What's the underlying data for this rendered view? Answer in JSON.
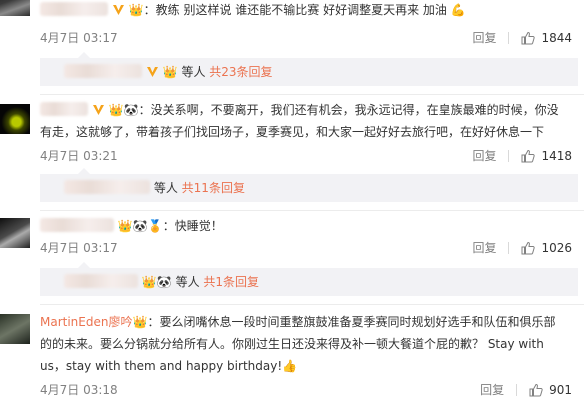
{
  "comments": [
    {
      "separator": "：",
      "text": "教练 别这样说 谁还能不输比赛 好好调整夏天再来 加油",
      "emoji": "💪",
      "time": "4月7日 03:17",
      "reply_label": "回复",
      "likes": "1844",
      "sub": {
        "suffix": "等人",
        "more": "共23条回复"
      }
    },
    {
      "separator": "：",
      "line1": "没关系啊，不要离开，我们还有机会，我永远记得，在皇族最难的时候，你没",
      "line2": "有走，这就够了，带着孩子们找回场子，夏季赛见，和大家一起好好去旅行吧，在好好休息一下",
      "time": "4月7日 03:21",
      "reply_label": "回复",
      "likes": "1418",
      "sub": {
        "suffix": "等人",
        "more": "共11条回复"
      }
    },
    {
      "separator": "：",
      "text": "快睡觉！",
      "time": "4月7日 03:17",
      "reply_label": "回复",
      "likes": "1026",
      "sub": {
        "suffix": "等人",
        "more": "共1条回复"
      }
    },
    {
      "name": "MartinEden廖吟",
      "separator": "：",
      "line1": "要么闭嘴休息一段时间重整旗鼓准备夏季赛同时规划好选手和队伍和俱乐部",
      "line2": "的的未来。要么分锅就分给所有人。你刚过生日还没来得及补一顿大餐道个屁的歉？ Stay with",
      "line3": "us，stay with them and happy birthday!",
      "emoji": "👍",
      "time": "4月7日 03:18",
      "reply_label": "回复",
      "likes": "901"
    }
  ],
  "colors": {
    "name": "#eb7350",
    "meta": "#808080",
    "text": "#333333",
    "sub_bg": "#f2f2f5"
  }
}
